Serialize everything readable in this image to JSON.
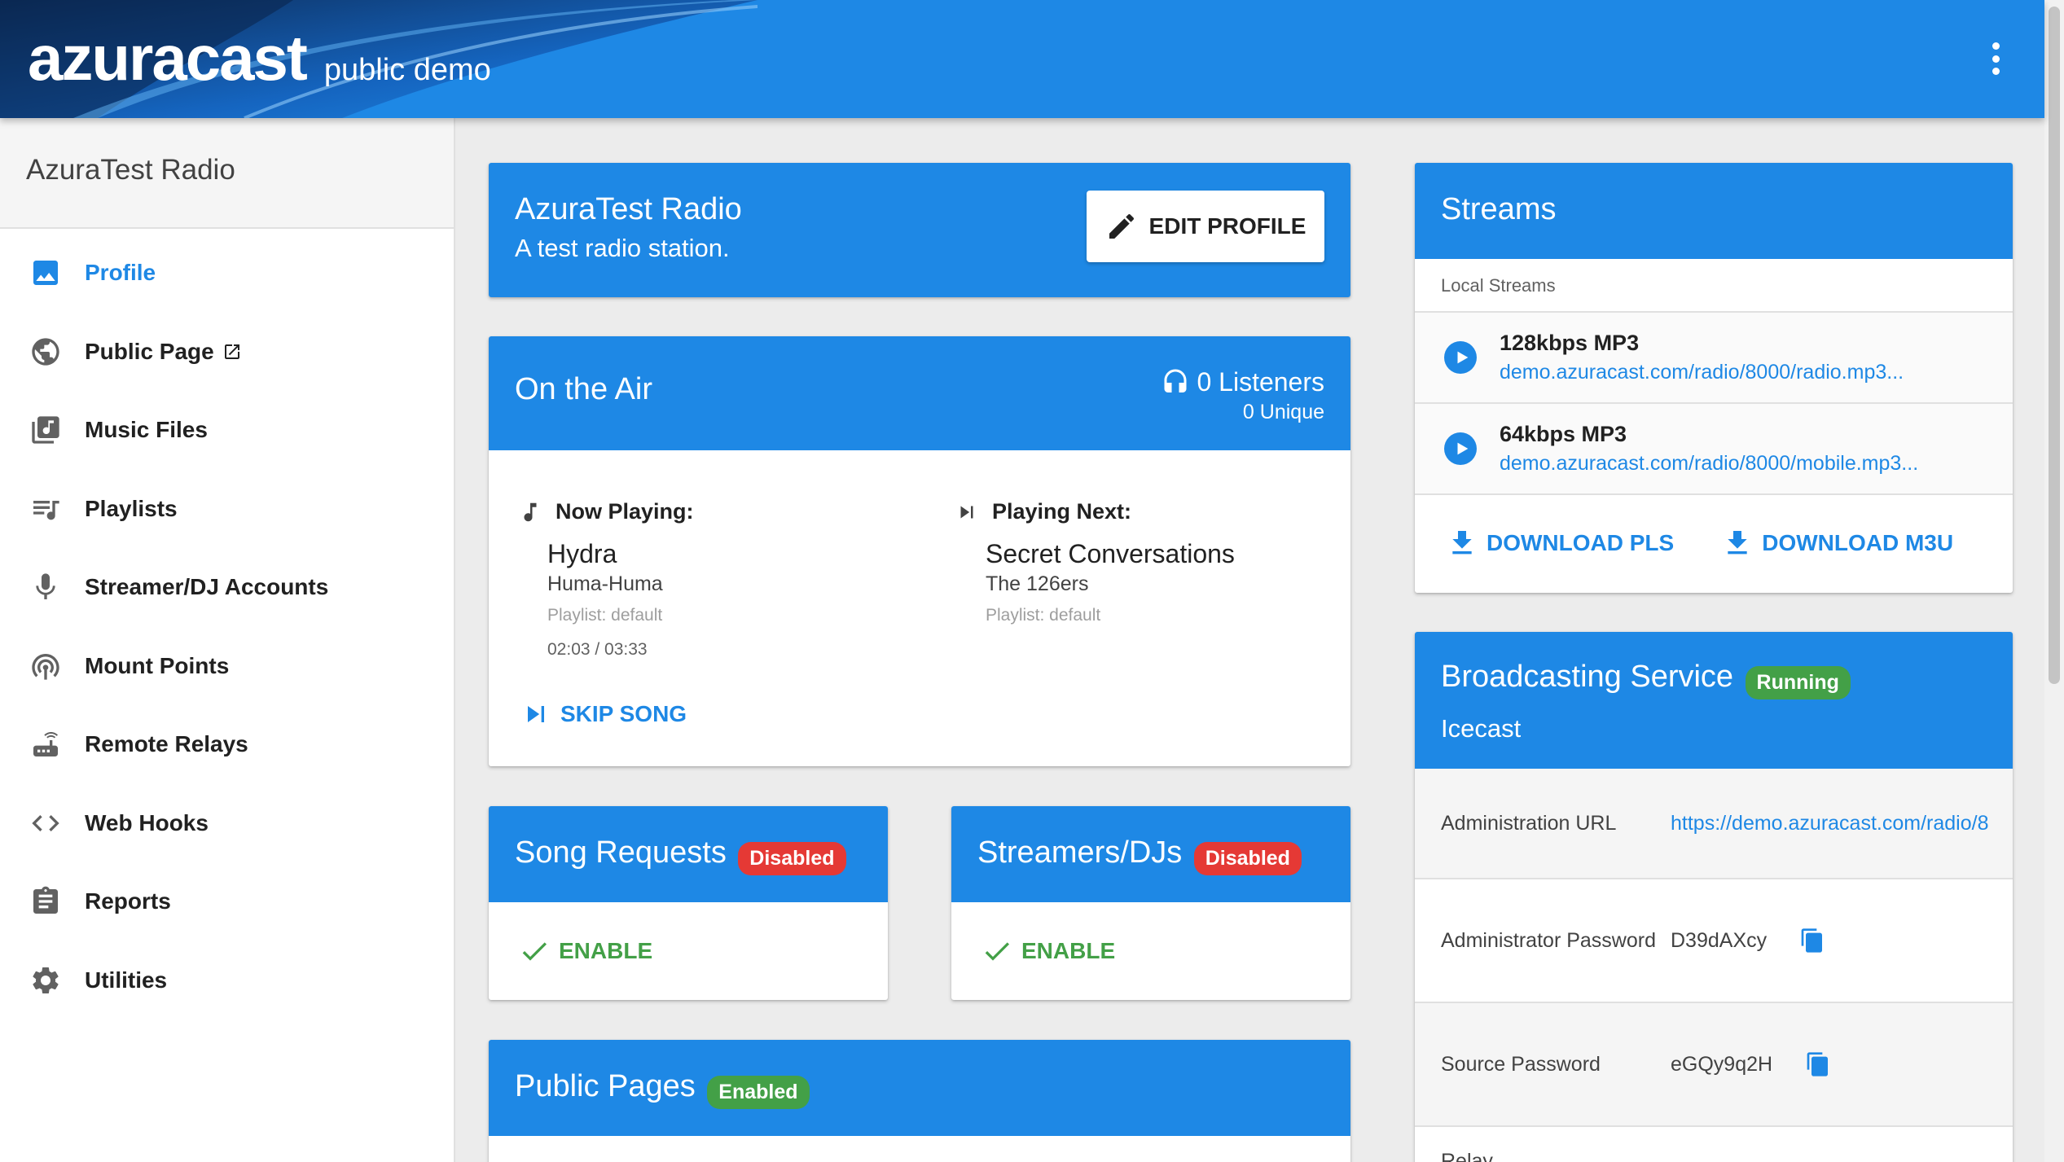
{
  "header": {
    "logo": "azuracast",
    "subtitle": "public demo"
  },
  "sidebar": {
    "station": "AzuraTest Radio",
    "items": [
      {
        "label": "Profile",
        "icon": "image-icon"
      },
      {
        "label": "Public Page",
        "icon": "globe-icon"
      },
      {
        "label": "Music Files",
        "icon": "library-music-icon"
      },
      {
        "label": "Playlists",
        "icon": "playlist-icon"
      },
      {
        "label": "Streamer/DJ Accounts",
        "icon": "microphone-icon"
      },
      {
        "label": "Mount Points",
        "icon": "podcast-icon"
      },
      {
        "label": "Remote Relays",
        "icon": "router-icon"
      },
      {
        "label": "Web Hooks",
        "icon": "code-icon"
      },
      {
        "label": "Reports",
        "icon": "assignment-icon"
      },
      {
        "label": "Utilities",
        "icon": "settings-icon"
      }
    ]
  },
  "profile": {
    "name": "AzuraTest Radio",
    "description": "A test radio station.",
    "edit_label": "EDIT PROFILE"
  },
  "on_air": {
    "title": "On the Air",
    "listeners": "0 Listeners",
    "unique": "0 Unique",
    "now_playing": {
      "label": "Now Playing:",
      "title": "Hydra",
      "artist": "Huma-Huma",
      "playlist": "Playlist: default",
      "time": "02:03 / 03:33"
    },
    "playing_next": {
      "label": "Playing Next:",
      "title": "Secret Conversations",
      "artist": "The 126ers",
      "playlist": "Playlist: default"
    },
    "skip_label": "SKIP SONG"
  },
  "song_requests": {
    "title": "Song Requests",
    "status": "Disabled",
    "action": "ENABLE"
  },
  "streamers": {
    "title": "Streamers/DJs",
    "status": "Disabled",
    "action": "ENABLE"
  },
  "public_pages": {
    "title": "Public Pages",
    "status": "Enabled"
  },
  "streams": {
    "title": "Streams",
    "section": "Local Streams",
    "items": [
      {
        "name": "128kbps MP3",
        "url": "demo.azuracast.com/radio/8000/radio.mp3..."
      },
      {
        "name": "64kbps MP3",
        "url": "demo.azuracast.com/radio/8000/mobile.mp3..."
      }
    ],
    "download_pls": "DOWNLOAD PLS",
    "download_m3u": "DOWNLOAD M3U"
  },
  "broadcasting": {
    "title": "Broadcasting Service",
    "status": "Running",
    "server": "Icecast",
    "rows": [
      {
        "label": "Administration URL",
        "value": "https://demo.azuracast.com/radio/8"
      },
      {
        "label": "Administrator Password",
        "value": "D39dAXcy"
      },
      {
        "label": "Source Password",
        "value": "eGQy9q2H"
      },
      {
        "label": "Relay",
        "value": ""
      }
    ]
  },
  "colors": {
    "primary": "#1e88e5",
    "danger": "#e53935",
    "success": "#43a047"
  }
}
